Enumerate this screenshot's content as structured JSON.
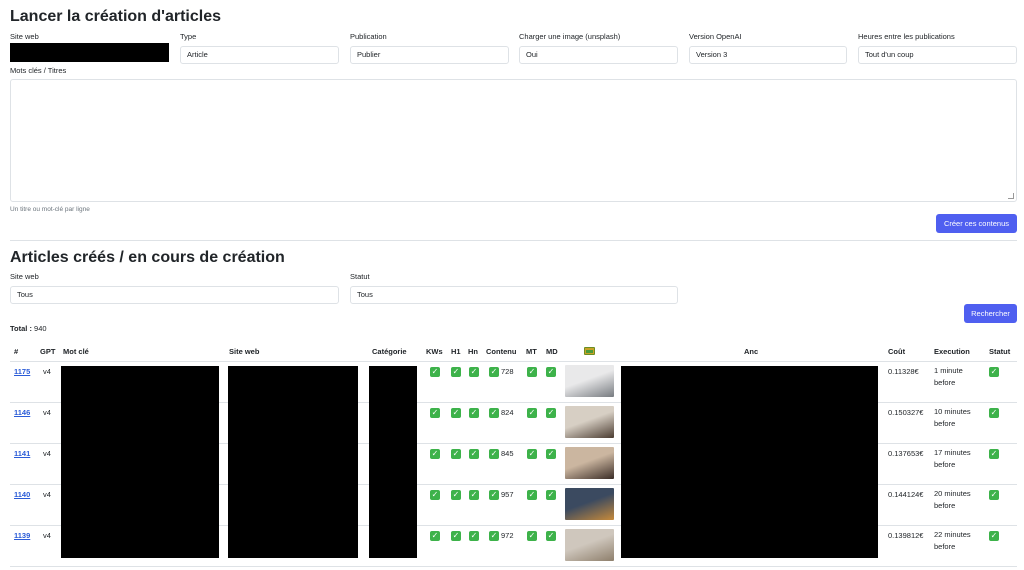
{
  "section1": {
    "title": "Lancer la création d'articles",
    "fields": {
      "site_web": {
        "label": "Site web"
      },
      "type": {
        "label": "Type",
        "value": "Article"
      },
      "publication": {
        "label": "Publication",
        "value": "Publier"
      },
      "image": {
        "label": "Charger une image (unsplash)",
        "value": "Oui"
      },
      "openai": {
        "label": "Version OpenAI",
        "value": "Version 3"
      },
      "heures": {
        "label": "Heures entre les publications",
        "value": "Tout d'un coup"
      }
    },
    "keywords_label": "Mots clés / Titres",
    "keywords_hint": "Un titre ou mot-clé par ligne",
    "create_button": "Créer ces contenus"
  },
  "section2": {
    "title": "Articles créés / en cours de création",
    "filter_site": {
      "label": "Site web",
      "value": "Tous"
    },
    "filter_status": {
      "label": "Statut",
      "value": "Tous"
    },
    "search_button": "Rechercher",
    "total_label": "Total :",
    "total_value": "940"
  },
  "table": {
    "headers": {
      "num": "#",
      "gpt": "GPT",
      "motcle": "Mot clé",
      "site": "Site web",
      "cat": "Catégorie",
      "kws": "KWs",
      "h1": "H1",
      "hn": "Hn",
      "contenu": "Contenu",
      "mt": "MT",
      "md": "MD",
      "img": "image-icon",
      "anc": "Anc",
      "cout": "Coût",
      "exec": "Execution",
      "statut": "Statut"
    },
    "rows": [
      {
        "id": "1175",
        "gpt": "v4",
        "contenu": "728",
        "cout": "0.11328€",
        "exec1": "1 minute",
        "exec2": "before"
      },
      {
        "id": "1146",
        "gpt": "v4",
        "contenu": "824",
        "cout": "0.150327€",
        "exec1": "10 minutes",
        "exec2": "before"
      },
      {
        "id": "1141",
        "gpt": "v4",
        "contenu": "845",
        "cout": "0.137653€",
        "exec1": "17 minutes",
        "exec2": "before"
      },
      {
        "id": "1140",
        "gpt": "v4",
        "contenu": "957",
        "cout": "0.144124€",
        "exec1": "20 minutes",
        "exec2": "before"
      },
      {
        "id": "1139",
        "gpt": "v4",
        "contenu": "972",
        "cout": "0.139812€",
        "exec1": "22 minutes",
        "exec2": "before"
      }
    ],
    "check_glyph": "✓",
    "colors": {
      "check": "#3db24a",
      "link": "#2a5bd7",
      "button": "#4f5ff0"
    }
  }
}
